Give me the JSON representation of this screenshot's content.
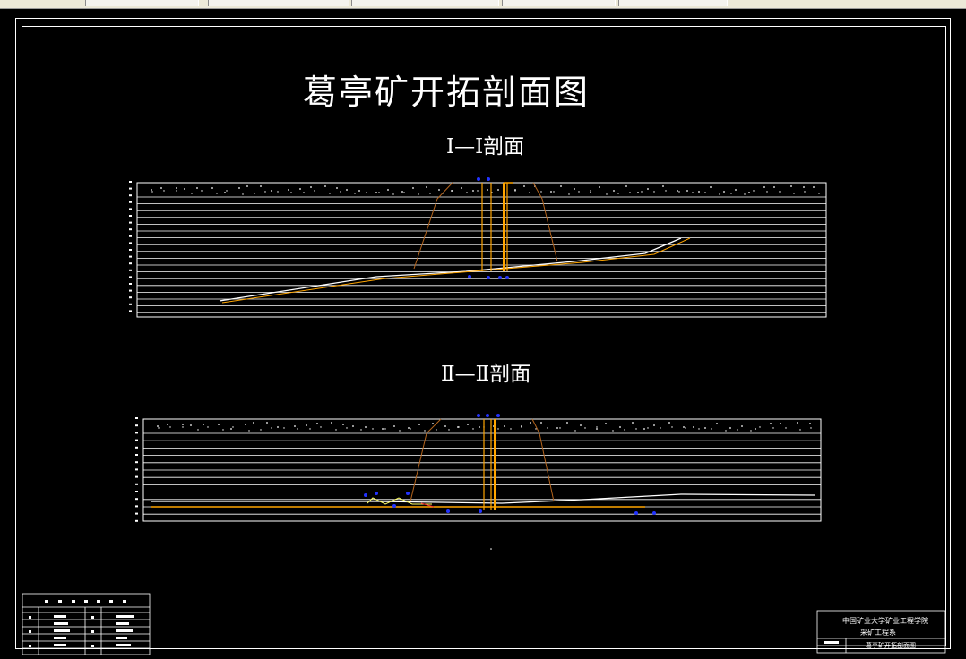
{
  "drawing": {
    "title": "葛亭矿开拓剖面图",
    "section_1_label": "Ⅰ—Ⅰ剖面",
    "section_2_label": "Ⅱ—Ⅱ剖面"
  },
  "title_block": {
    "school": "中国矿业大学矿业工程学院",
    "department": "采矿工程系",
    "drawing_name": "葛亭矿开拓剖面图"
  },
  "colors": {
    "background": "#000000",
    "lines": "#ffffff",
    "shaft": "#ffa500",
    "outline": "#b5651d",
    "markers": "#2233ff"
  }
}
